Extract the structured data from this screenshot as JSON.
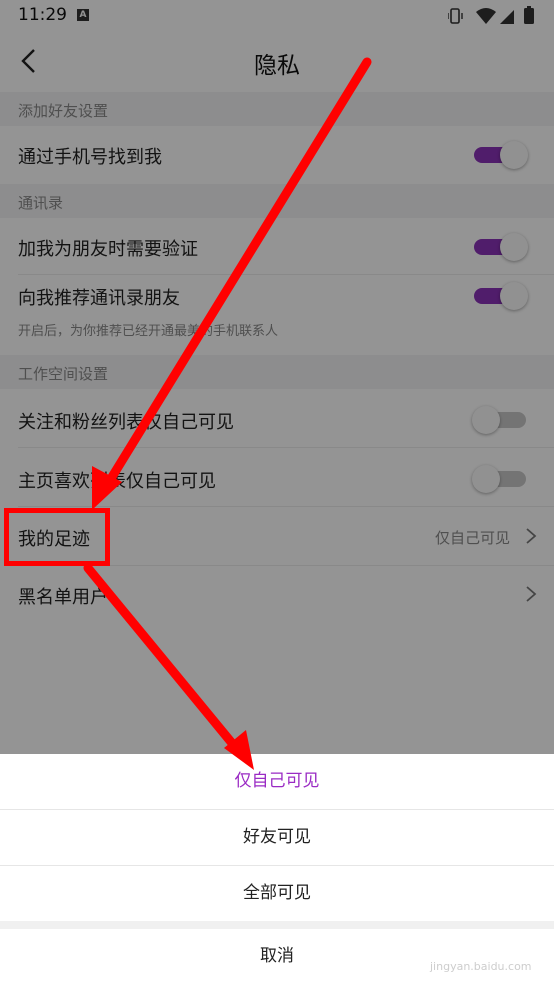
{
  "status": {
    "time": "11:29"
  },
  "header": {
    "title": "隐私"
  },
  "sections": [
    {
      "title": "添加好友设置"
    },
    {
      "title": "通讯录"
    },
    {
      "title": "工作空间设置"
    }
  ],
  "rows": {
    "find_by_phone": {
      "label": "通过手机号找到我",
      "toggle": "on"
    },
    "verify_friend": {
      "label": "加我为朋友时需要验证",
      "toggle": "on"
    },
    "recommend_contacts": {
      "label": "向我推荐通讯录朋友",
      "sub": "开启后，为你推荐已经开通最美的手机联系人",
      "toggle": "on"
    },
    "follow_list_private": {
      "label": "关注和粉丝列表仅自己可见",
      "toggle": "off"
    },
    "likes_private": {
      "label": "主页喜欢列表仅自己可见",
      "toggle": "off"
    },
    "footprints": {
      "label": "我的足迹",
      "value": "仅自己可见"
    },
    "blacklist": {
      "label": "黑名单用户"
    }
  },
  "sheet": {
    "options": [
      {
        "label": "仅自己可见",
        "selected": true
      },
      {
        "label": "好友可见",
        "selected": false
      },
      {
        "label": "全部可见",
        "selected": false
      }
    ],
    "cancel": "取消"
  },
  "colors": {
    "accent": "#8a32b8",
    "annotation": "#ff0000"
  },
  "watermark": {
    "brand": "Baidu",
    "sub": "jingyan.baidu.com"
  }
}
